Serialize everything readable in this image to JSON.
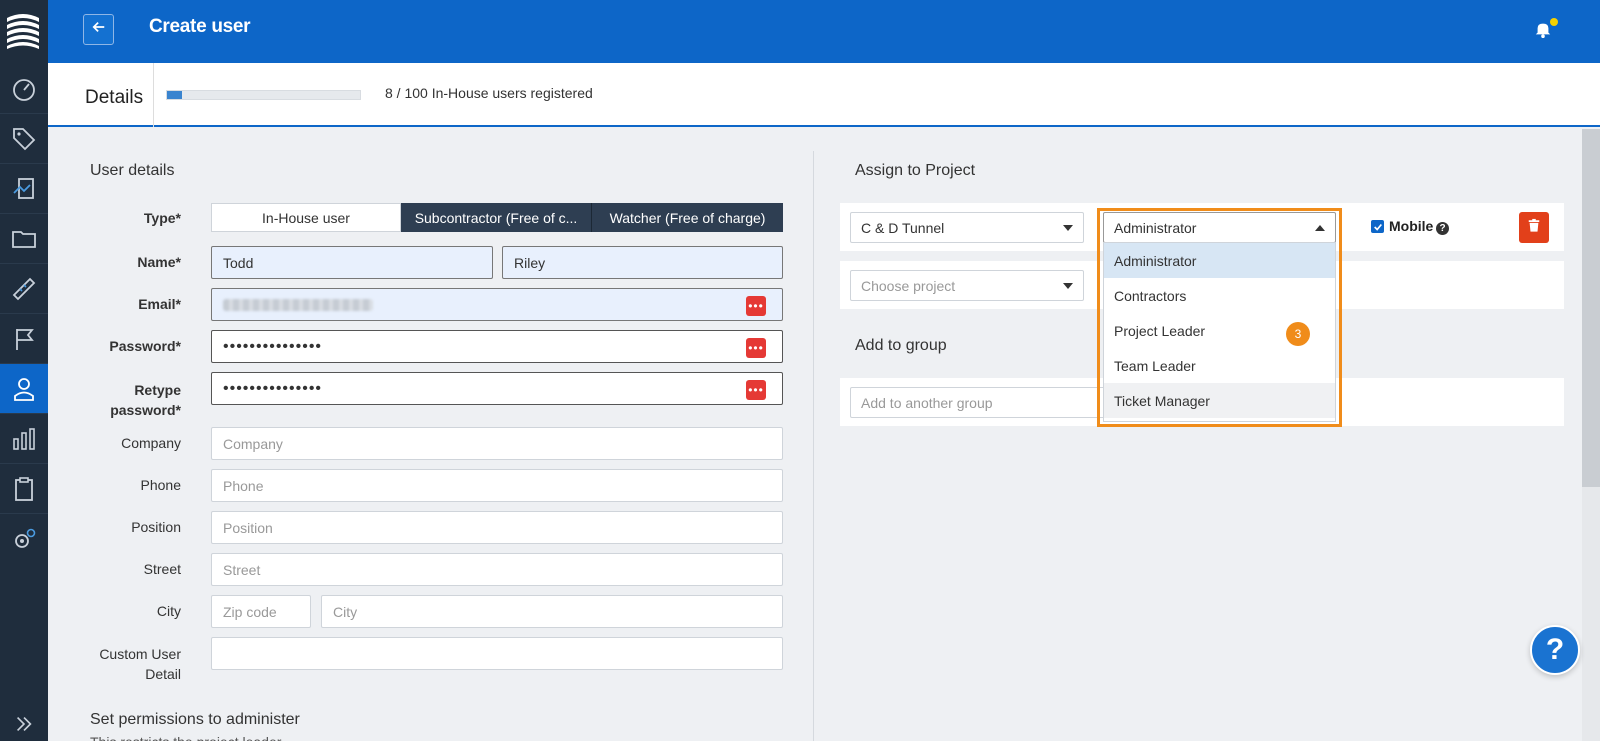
{
  "header": {
    "title": "Create user",
    "back_icon": "arrow-left-icon",
    "bell_icon": "bell-icon",
    "notification_dot_color": "#f5d000"
  },
  "details": {
    "title": "Details",
    "progress_fraction": 0.08,
    "users_registered": "8 / 100 In-House users registered"
  },
  "sidebar": {
    "items": [
      "dashboard-icon",
      "tags-icon",
      "reports-icon",
      "folder-icon",
      "ruler-icon",
      "flag-icon",
      "user-icon",
      "chart-icon",
      "clipboard-icon",
      "settings-icon"
    ],
    "active": "user-icon",
    "collapse_icon": "double-chevron-right-icon"
  },
  "user_details": {
    "section_title": "User details",
    "type_label": "Type*",
    "type_options": [
      "In-House user",
      "Subcontractor (Free of c...",
      "Watcher (Free of charge)"
    ],
    "name_label": "Name*",
    "first_name": "Todd",
    "last_name": "Riley",
    "email_label": "Email*",
    "password_label": "Password*",
    "password_value": "•••••••••••••••",
    "retype_label_1": "Retype",
    "retype_label_2": "password*",
    "retype_value": "•••••••••••••••",
    "company_label": "Company",
    "company_placeholder": "Company",
    "phone_label": "Phone",
    "phone_placeholder": "Phone",
    "position_label": "Position",
    "position_placeholder": "Position",
    "street_label": "Street",
    "street_placeholder": "Street",
    "city_label": "City",
    "zip_placeholder": "Zip code",
    "city_placeholder": "City",
    "custom_label_1": "Custom User",
    "custom_label_2": "Detail",
    "custom_value": ""
  },
  "permissions": {
    "section_title": "Set permissions to administer",
    "subtitle": "This restricts the project leader..."
  },
  "assign": {
    "section_title": "Assign to Project",
    "project": "C & D Tunnel",
    "role": "Administrator",
    "role_options": [
      "Administrator",
      "Contractors",
      "Project Leader",
      "Team Leader",
      "Ticket Manager"
    ],
    "mobile_label": "Mobile",
    "mobile_checked": true,
    "choose_project_placeholder": "Choose project"
  },
  "group": {
    "section_title": "Add to group",
    "placeholder": "Add to another group"
  },
  "step_badge": "3",
  "help_fab": "?",
  "colors": {
    "primary": "#0d66c8",
    "sidebar": "#1f2d3d",
    "danger": "#e53935",
    "highlight": "#f08c1a"
  }
}
